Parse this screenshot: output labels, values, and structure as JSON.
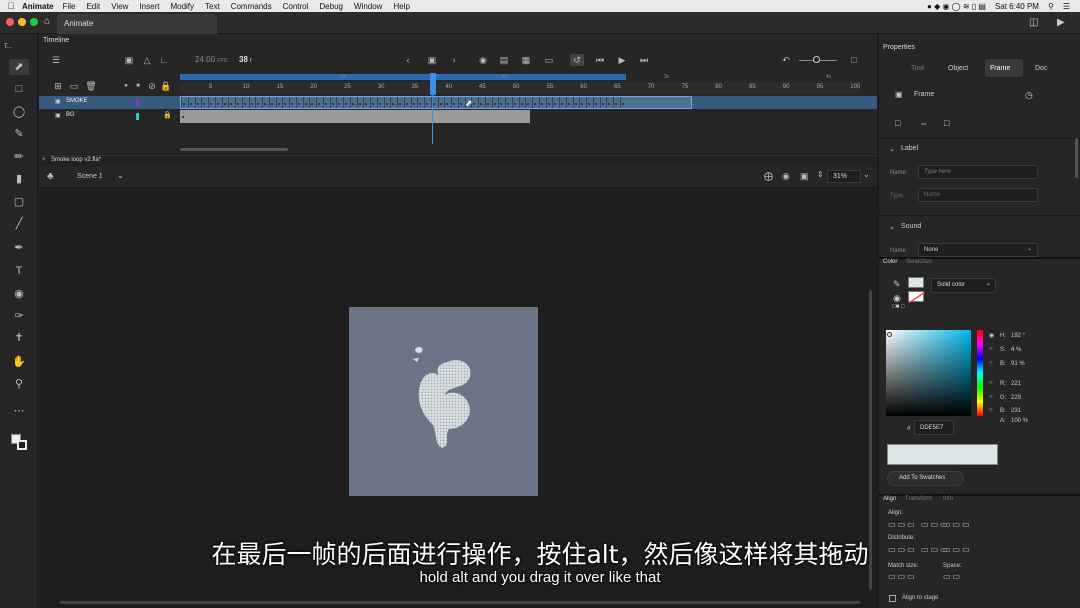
{
  "menubar": {
    "app": "Animate",
    "items": [
      "File",
      "Edit",
      "View",
      "Insert",
      "Modify",
      "Text",
      "Commands",
      "Control",
      "Debug",
      "Window",
      "Help"
    ],
    "clock": "Sat 6:40 PM"
  },
  "titlebar": {
    "tab": "Animate"
  },
  "tools": {
    "panel_label": "T..."
  },
  "timeline": {
    "label": "Timeline",
    "fps": "24.00",
    "fps_unit": "FPS",
    "current_frame": "38",
    "frame_unit": "f",
    "ruler_marks": [
      "5",
      "10",
      "15",
      "20",
      "25",
      "30",
      "35",
      "40",
      "45",
      "50",
      "55",
      "60",
      "65",
      "70",
      "75",
      "80",
      "85",
      "90",
      "95",
      "100"
    ],
    "time_marks": [
      "1s",
      "2s",
      "3s",
      "4s"
    ],
    "layers": [
      {
        "name": "SMOKE",
        "color": "#8a3ab9"
      },
      {
        "name": "BG",
        "color": "#22d3c5"
      }
    ]
  },
  "document": {
    "tab": "Smoke loop v2.fla*",
    "scene": "Scene 1",
    "zoom": "31%"
  },
  "properties": {
    "title": "Properties",
    "tabs": [
      "Tool",
      "Object",
      "Frame",
      "Doc"
    ],
    "active_tab": "Frame",
    "frame_label": "Frame",
    "label_section": "Label",
    "name_label": "Name",
    "name_placeholder": "Type here",
    "type_label": "Type",
    "type_value": "Name",
    "sound_section": "Sound",
    "sound_name_label": "Name",
    "sound_name_value": "None"
  },
  "color": {
    "tabs": [
      "Color",
      "Swatches"
    ],
    "fill_type": "Solid color",
    "hsb": {
      "h_label": "H:",
      "h": "192 °",
      "s_label": "S:",
      "s": "4 %",
      "b_label": "B:",
      "b": "91 %"
    },
    "rgb": {
      "r_label": "R:",
      "r": "221",
      "g_label": "G:",
      "g": "229",
      "b_label": "B:",
      "b": "231"
    },
    "alpha_label": "A:",
    "alpha": "100 %",
    "hex_prefix": "#",
    "hex": "DDE5E7",
    "swatch_color": "#dde5e7",
    "add_button": "Add To Swatches"
  },
  "align": {
    "tabs": [
      "Align",
      "Transform",
      "Info"
    ],
    "align_label": "Align:",
    "distribute_label": "Distribute:",
    "match_label": "Match size:",
    "space_label": "Space:",
    "stage_checkbox": "Align to stage"
  },
  "subtitles": {
    "chinese": "在最后一帧的后面进行操作，按住alt，然后像这样将其拖动",
    "english": "hold alt and you drag it over like that"
  }
}
